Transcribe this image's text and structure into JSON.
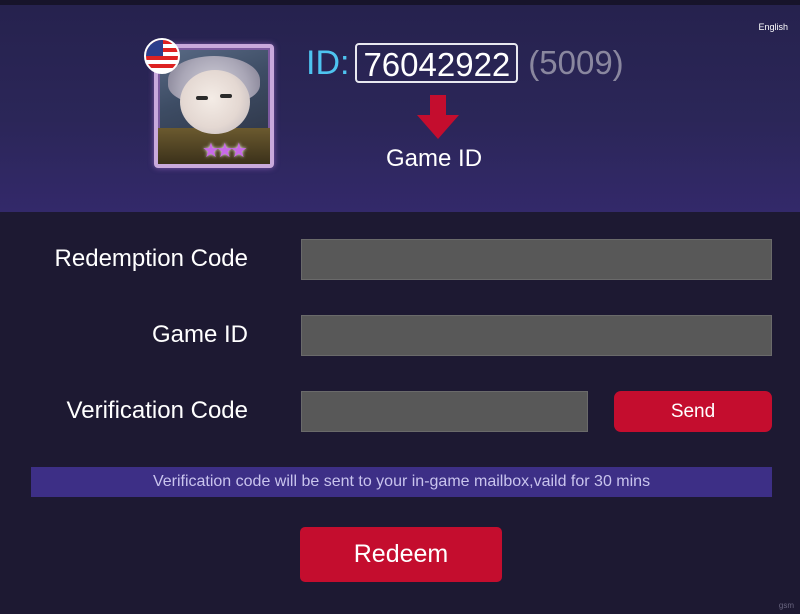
{
  "header": {
    "language": "English",
    "id_label": "ID:",
    "player_id": "76042922",
    "id_extra": "(5009)",
    "arrow_caption": "Game ID"
  },
  "form": {
    "redemption_code_label": "Redemption Code",
    "redemption_code_value": "",
    "game_id_label": "Game ID",
    "game_id_value": "",
    "verification_code_label": "Verification Code",
    "verification_code_value": "",
    "send_label": "Send",
    "notice": "Verification code will be sent to your in-game mailbox,vaild for 30 mins",
    "redeem_label": "Redeem"
  },
  "watermark": "gsm",
  "colors": {
    "accent_red": "#c40d2e",
    "id_blue": "#4ec4f0",
    "notice_bg": "#3d2f86",
    "page_bg": "#1d1932"
  },
  "icons": {
    "flag": "us-flag-icon",
    "avatar": "hero-avatar",
    "arrow": "arrow-down-icon",
    "stars": "star-icon"
  }
}
